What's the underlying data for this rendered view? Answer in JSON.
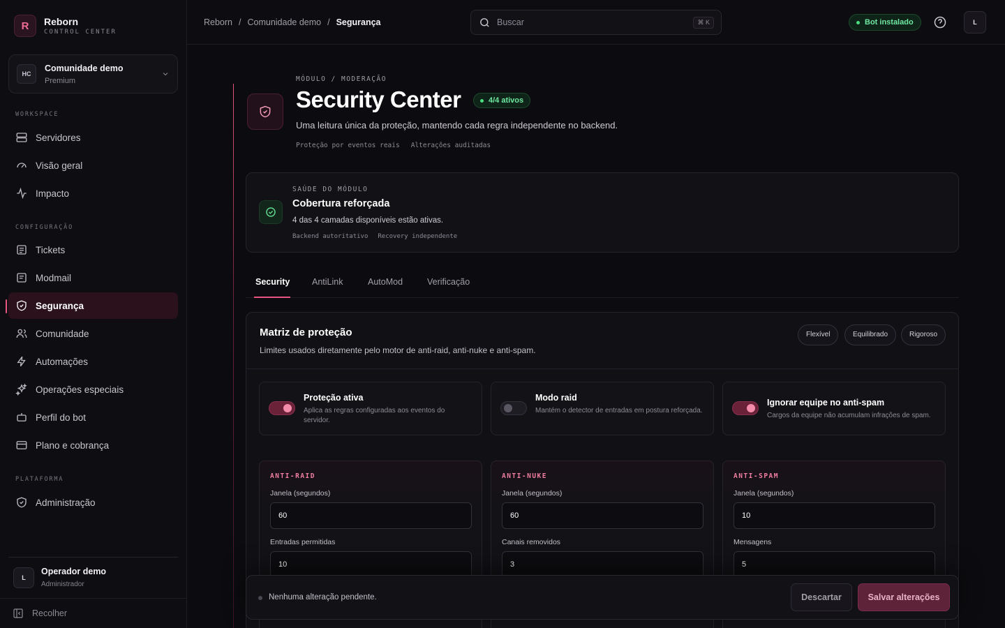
{
  "brand": {
    "name": "Reborn",
    "subtitle": "CONTROL CENTER",
    "logo_letter": "R",
    "accent": "#e8557f"
  },
  "community": {
    "initials": "HC",
    "name": "Comunidade demo",
    "plan": "Premium"
  },
  "sidebar": {
    "sections": [
      {
        "label": "WORKSPACE",
        "items": [
          {
            "label": "Servidores",
            "icon": "server-icon"
          },
          {
            "label": "Visão geral",
            "icon": "gauge-icon"
          },
          {
            "label": "Impacto",
            "icon": "activity-icon"
          }
        ]
      },
      {
        "label": "CONFIGURAÇÃO",
        "items": [
          {
            "label": "Tickets",
            "icon": "ticket-icon"
          },
          {
            "label": "Modmail",
            "icon": "mail-icon"
          },
          {
            "label": "Segurança",
            "icon": "shield-icon",
            "active": true
          },
          {
            "label": "Comunidade",
            "icon": "users-icon"
          },
          {
            "label": "Automações",
            "icon": "zap-icon"
          },
          {
            "label": "Operações especiais",
            "icon": "sparkles-icon"
          },
          {
            "label": "Perfil do bot",
            "icon": "bot-icon"
          },
          {
            "label": "Plano e cobrança",
            "icon": "credit-card-icon"
          }
        ]
      },
      {
        "label": "PLATAFORMA",
        "items": [
          {
            "label": "Administração",
            "icon": "shield-check-icon"
          }
        ]
      }
    ]
  },
  "operator": {
    "initial": "L",
    "name": "Operador demo",
    "role": "Administrador"
  },
  "collapse_label": "Recolher",
  "header": {
    "breadcrumb": [
      "Reborn",
      "Comunidade demo",
      "Segurança"
    ],
    "separator": "/",
    "search_placeholder": "Buscar",
    "search_shortcut": "⌘ K",
    "bot_status": "Bot instalado",
    "user_initial": "L"
  },
  "hero": {
    "eyebrow": "MÓDULO / MODERAÇÃO",
    "title": "Security Center",
    "badge": "4/4 ativos",
    "description": "Uma leitura única da proteção, mantendo cada regra independente no backend.",
    "tags": [
      "Proteção por eventos reais",
      "Alterações auditadas"
    ]
  },
  "health": {
    "eyebrow": "SAÚDE DO MÓDULO",
    "title": "Cobertura reforçada",
    "description": "4 das 4 camadas disponíveis estão ativas.",
    "tags": [
      "Backend autoritativo",
      "Recovery independente"
    ]
  },
  "tabs": [
    "Security",
    "AntiLink",
    "AutoMod",
    "Verificação"
  ],
  "matrix": {
    "title": "Matriz de proteção",
    "description": "Limites usados diretamente pelo motor de anti-raid, anti-nuke e anti-spam.",
    "presets": [
      "Flexível",
      "Equilibrado",
      "Rigoroso"
    ],
    "toggles": [
      {
        "title": "Proteção ativa",
        "description": "Aplica as regras configuradas aos eventos do servidor.",
        "on": true
      },
      {
        "title": "Modo raid",
        "description": "Mantém o detector de entradas em postura reforçada.",
        "on": false
      },
      {
        "title": "Ignorar equipe no anti-spam",
        "description": "Cargos da equipe não acumulam infrações de spam.",
        "on": true
      }
    ],
    "cards": [
      {
        "eyebrow": "ANTI-RAID",
        "fields": [
          {
            "label": "Janela (segundos)",
            "value": "60"
          },
          {
            "label": "Entradas permitidas",
            "value": "10"
          }
        ]
      },
      {
        "eyebrow": "ANTI-NUKE",
        "fields": [
          {
            "label": "Janela (segundos)",
            "value": "60"
          },
          {
            "label": "Canais removidos",
            "value": "3"
          }
        ]
      },
      {
        "eyebrow": "ANTI-SPAM",
        "fields": [
          {
            "label": "Janela (segundos)",
            "value": "10"
          },
          {
            "label": "Mensagens",
            "value": "5"
          }
        ]
      }
    ]
  },
  "savebar": {
    "status": "Nenhuma alteração pendente.",
    "discard": "Descartar",
    "save": "Salvar alterações"
  }
}
